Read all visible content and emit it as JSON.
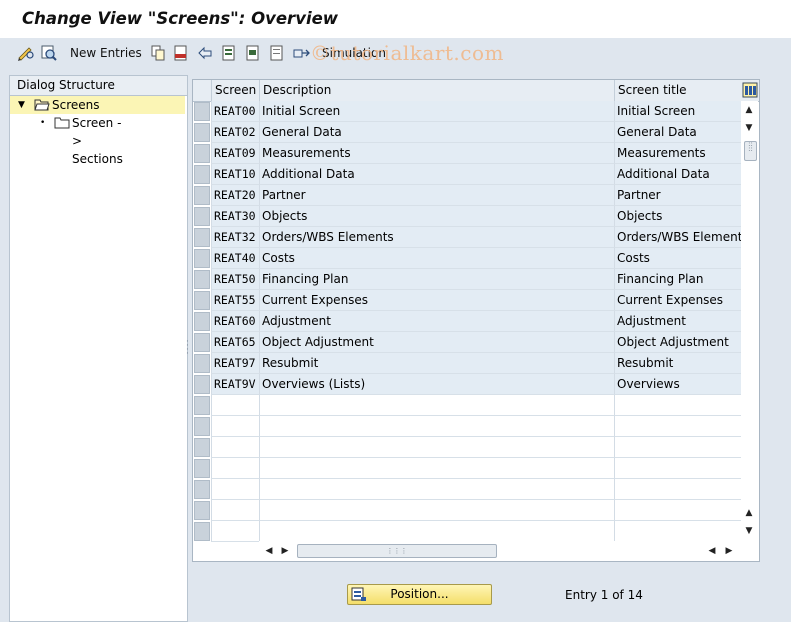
{
  "title": "Change View \"Screens\": Overview",
  "toolbar": {
    "new_entries": "New Entries",
    "simulation": "Simulation",
    "icons": [
      "edit-glasses-icon",
      "display-icon",
      "copy-icon",
      "delete-icon",
      "undo-icon",
      "select-all-icon",
      "select-block-icon",
      "deselect-all-icon",
      "transport-icon"
    ]
  },
  "watermark": "©tutorialkart.com",
  "dialog_structure": {
    "header": "Dialog Structure",
    "items": [
      {
        "label": "Screens",
        "selected": true,
        "level": 0
      },
      {
        "label": "Screen -> Sections",
        "selected": false,
        "level": 1
      }
    ]
  },
  "table": {
    "columns": [
      "Screen",
      "Description",
      "Screen title"
    ],
    "rows": [
      {
        "screen": "REAT00",
        "description": "Initial Screen",
        "title": "Initial Screen"
      },
      {
        "screen": "REAT02",
        "description": "General Data",
        "title": "General Data"
      },
      {
        "screen": "REAT09",
        "description": "Measurements",
        "title": "Measurements"
      },
      {
        "screen": "REAT10",
        "description": "Additional Data",
        "title": "Additional Data"
      },
      {
        "screen": "REAT20",
        "description": "Partner",
        "title": "Partner"
      },
      {
        "screen": "REAT30",
        "description": "Objects",
        "title": "Objects"
      },
      {
        "screen": "REAT32",
        "description": "Orders/WBS Elements",
        "title": "Orders/WBS Elements"
      },
      {
        "screen": "REAT40",
        "description": "Costs",
        "title": "Costs"
      },
      {
        "screen": "REAT50",
        "description": "Financing Plan",
        "title": "Financing Plan"
      },
      {
        "screen": "REAT55",
        "description": "Current Expenses",
        "title": "Current Expenses"
      },
      {
        "screen": "REAT60",
        "description": "Adjustment",
        "title": "Adjustment"
      },
      {
        "screen": "REAT65",
        "description": "Object Adjustment",
        "title": "Object Adjustment"
      },
      {
        "screen": "REAT97",
        "description": "Resubmit",
        "title": "Resubmit"
      },
      {
        "screen": "REAT9V",
        "description": "Overviews (Lists)",
        "title": "Overviews"
      }
    ],
    "empty_rows": 7
  },
  "footer": {
    "position_label": "Position...",
    "entry_text": "Entry 1 of 14"
  },
  "colors": {
    "background": "#dfe6ee",
    "row_fill": "#e3ecf4",
    "tree_selected": "#fbf5b5",
    "button_yellow": "#f4de6a"
  }
}
